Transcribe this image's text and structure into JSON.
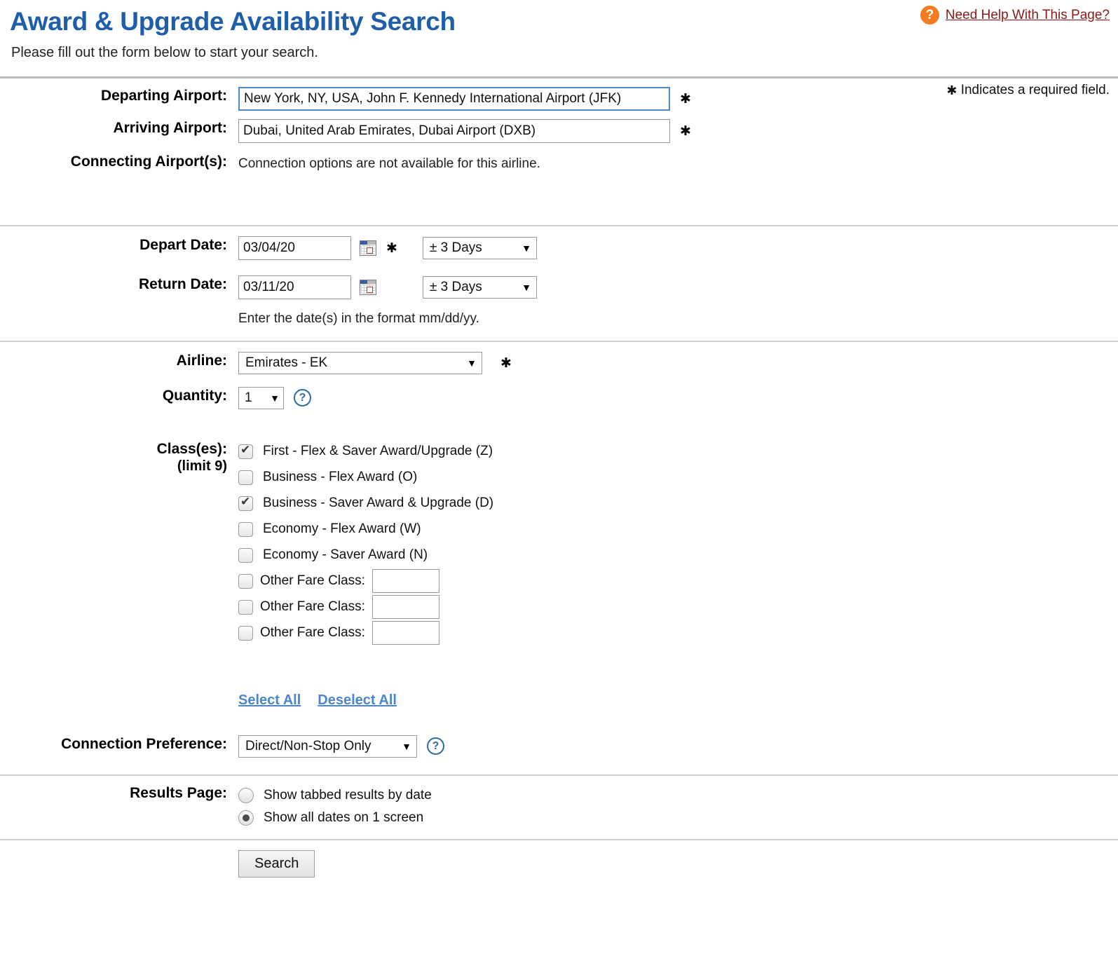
{
  "header": {
    "title": "Award & Upgrade Availability Search",
    "subtitle": "Please fill out the form below to start your search.",
    "help_link": "Need Help With This Page?",
    "help_icon": "question-mark-circle-icon",
    "required_note": "Indicates a required field.",
    "required_star": "✱"
  },
  "colors": {
    "title_blue": "#1F5FA9",
    "help_orange": "#F47B20",
    "help_link_maroon": "#8C1919",
    "link_blue": "#4A86C8",
    "focus_border": "#4B8BCB"
  },
  "airports": {
    "departing_label": "Departing Airport:",
    "departing_value": "New York, NY, USA, John F. Kennedy International Airport (JFK)",
    "arriving_label": "Arriving Airport:",
    "arriving_value": "Dubai, United Arab Emirates, Dubai Airport (DXB)",
    "connecting_label": "Connecting Airport(s):",
    "connecting_text": "Connection options are not available for this airline."
  },
  "dates": {
    "depart_label": "Depart Date:",
    "depart_value": "03/04/20",
    "depart_flex": "± 3 Days",
    "return_label": "Return Date:",
    "return_value": "03/11/20",
    "return_flex": "± 3 Days",
    "format_hint": "Enter the date(s) in the format mm/dd/yy."
  },
  "airline": {
    "label": "Airline:",
    "value": "Emirates - EK"
  },
  "quantity": {
    "label": "Quantity:",
    "value": "1"
  },
  "classes": {
    "label": "Class(es):",
    "limit_label": "(limit 9)",
    "items": [
      {
        "label": "First - Flex & Saver Award/Upgrade (Z)",
        "checked": true
      },
      {
        "label": "Business - Flex Award (O)",
        "checked": false
      },
      {
        "label": "Business - Saver Award & Upgrade (D)",
        "checked": true
      },
      {
        "label": "Economy - Flex Award (W)",
        "checked": false
      },
      {
        "label": "Economy - Saver Award (N)",
        "checked": false
      }
    ],
    "other_label": "Other Fare Class:",
    "other_fields": [
      {
        "checked": false,
        "value": ""
      },
      {
        "checked": false,
        "value": ""
      },
      {
        "checked": false,
        "value": ""
      }
    ],
    "select_all": "Select All",
    "deselect_all": "Deselect All"
  },
  "connection": {
    "label": "Connection Preference:",
    "value": "Direct/Non-Stop Only"
  },
  "results_page": {
    "label": "Results Page:",
    "options": [
      {
        "label": "Show tabbed results by date",
        "selected": false
      },
      {
        "label": "Show all dates on 1 screen",
        "selected": true
      }
    ]
  },
  "actions": {
    "search_label": "Search"
  }
}
